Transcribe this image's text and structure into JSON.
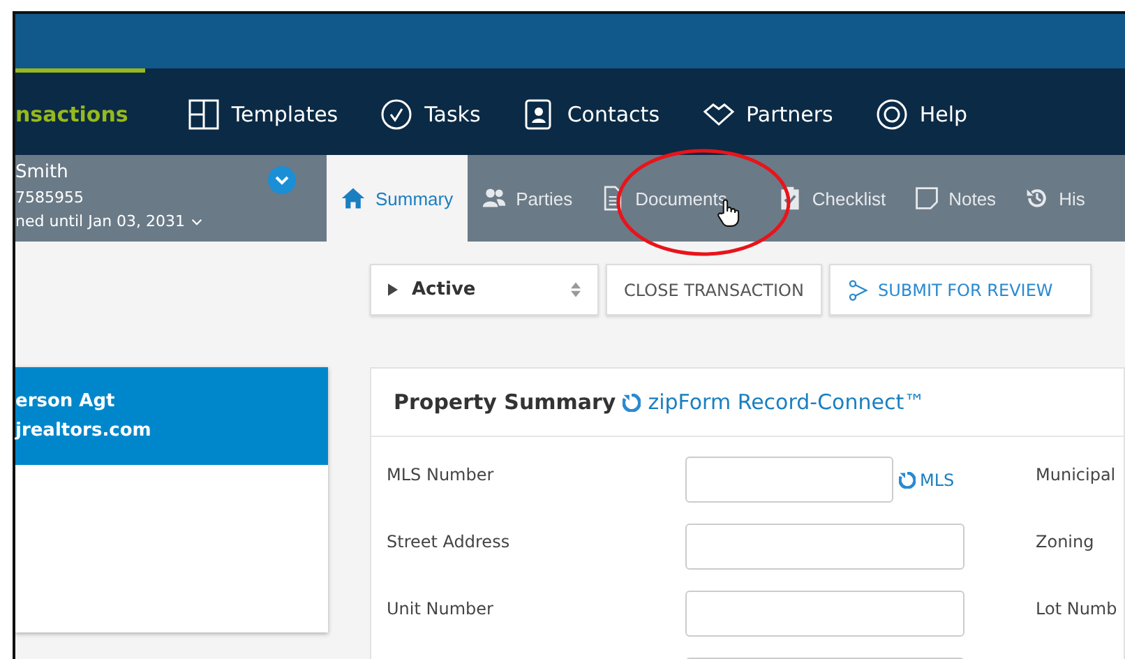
{
  "nav": {
    "items": [
      {
        "label": "nsactions",
        "selected": true
      },
      {
        "label": "Templates",
        "selected": false
      },
      {
        "label": "Tasks",
        "selected": false
      },
      {
        "label": "Contacts",
        "selected": false
      },
      {
        "label": "Partners",
        "selected": false
      },
      {
        "label": "Help",
        "selected": false
      }
    ]
  },
  "user": {
    "name": "Smith",
    "phone": "7585955",
    "plan": "ned until Jan 03, 2031"
  },
  "tabs": [
    {
      "label": "Summary",
      "selected": true
    },
    {
      "label": "Parties",
      "selected": false
    },
    {
      "label": "Documents",
      "selected": false
    },
    {
      "label": "Checklist",
      "selected": false
    },
    {
      "label": "Notes",
      "selected": false
    },
    {
      "label": "His",
      "selected": false
    }
  ],
  "status_select": {
    "value": "Active"
  },
  "actions": [
    "CLOSE TRANSACTION",
    "SUBMIT FOR REVIEW"
  ],
  "agent_card": {
    "name": "erson Agt",
    "email": "jrealtors.com"
  },
  "property_summary": {
    "title": "Property Summary",
    "link": "zipForm Record-Connect™",
    "fields": [
      {
        "kind": "lookup",
        "label": "MLS Number",
        "link": "MLS"
      },
      {
        "kind": "text",
        "label": "Street Address"
      },
      {
        "kind": "text",
        "label": "Unit Number"
      },
      {
        "kind": "blank"
      }
    ],
    "right_labels": [
      "Municipal",
      "Zoning",
      "Lot Numb"
    ]
  }
}
